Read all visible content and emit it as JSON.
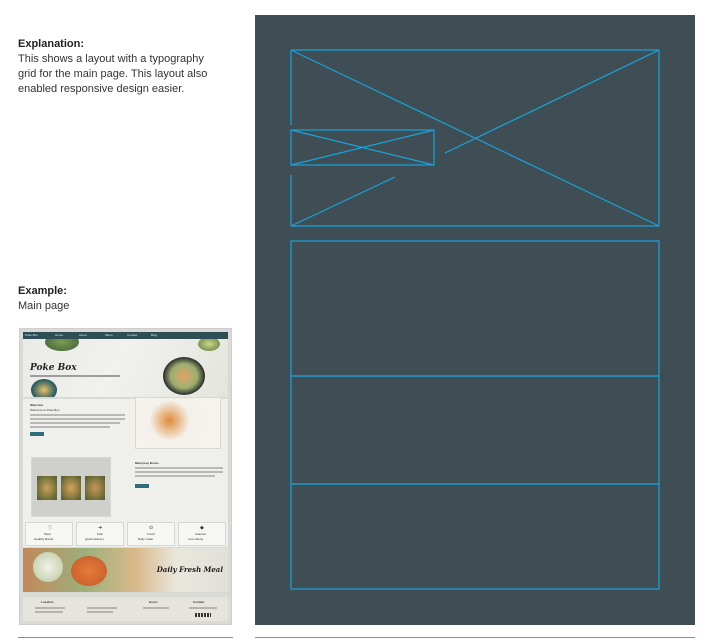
{
  "explanation": {
    "heading": "Explanation:",
    "text": "This shows a layout with a typography grid for the main page. This layout also enabled responsive design easier."
  },
  "example": {
    "heading": "Example:",
    "text": "Main page"
  },
  "thumbnail": {
    "nav_items": [
      "Poke Box",
      "Home",
      "About",
      "Menu",
      "Contact",
      "Blog"
    ],
    "hero_title": "Poke Box",
    "welcome_heading": "Welcome",
    "welcome_sub": "Welcome to Poke Box",
    "meal_heading": "Meal prep Boxes",
    "features": [
      {
        "icon": "🍴",
        "title": "Meal",
        "text": "Healthy Bowls"
      },
      {
        "icon": "➜",
        "title": "Fast",
        "text": "Quick delivery"
      },
      {
        "icon": "⊙",
        "title": "Fresh",
        "text": "Daily made"
      },
      {
        "icon": "◆",
        "title": "Calories",
        "text": "Low calorie"
      }
    ],
    "banner_title": "Daily Fresh Meal",
    "footer_columns": [
      "Location",
      "Hours",
      "Contact"
    ]
  },
  "colors": {
    "wire_panel_bg": "#3f4d55",
    "wire_stroke": "#1aa3d9",
    "thumb_nav": "#2f4d55",
    "button": "#2f6d7a"
  }
}
